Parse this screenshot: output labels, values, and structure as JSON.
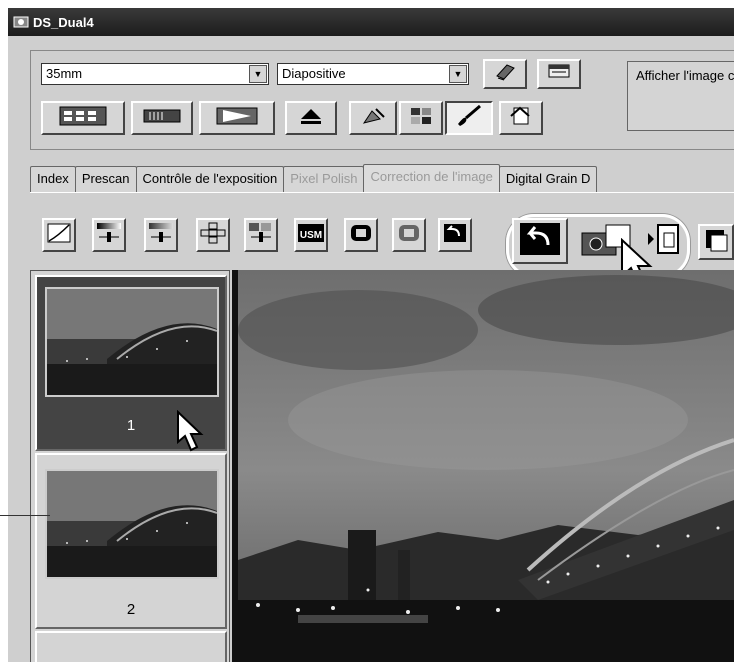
{
  "window": {
    "title": "DS_Dual4"
  },
  "controls": {
    "film_format": "35mm",
    "film_type": "Diapositive",
    "message": "Afficher l'image c"
  },
  "tabs": [
    {
      "label": "Index",
      "state": "normal"
    },
    {
      "label": "Prescan",
      "state": "normal"
    },
    {
      "label": "Contrôle de l'exposition",
      "state": "normal"
    },
    {
      "label": "Pixel Polish",
      "state": "disabled"
    },
    {
      "label": "Correction de l'image",
      "state": "active"
    },
    {
      "label": "Digital Grain D",
      "state": "normal"
    }
  ],
  "toolbar_icons": [
    "tone-curve-icon",
    "brightness-contrast-icon",
    "color-balance-icon",
    "variations-icon",
    "hue-saturation-icon",
    "unsharp-mask-icon",
    "undo-icon",
    "redo-icon",
    "reset-icon",
    "undo-large-icon",
    "snapshot-icon",
    "compare-icon",
    "save-icon"
  ],
  "thumbnails": [
    {
      "frame": "1",
      "selected": true
    },
    {
      "frame": "2",
      "selected": false
    }
  ],
  "colors": {
    "titlebar": "#1c1c1c",
    "panel": "#cfcfcf",
    "selected_thumb": "#444444"
  }
}
